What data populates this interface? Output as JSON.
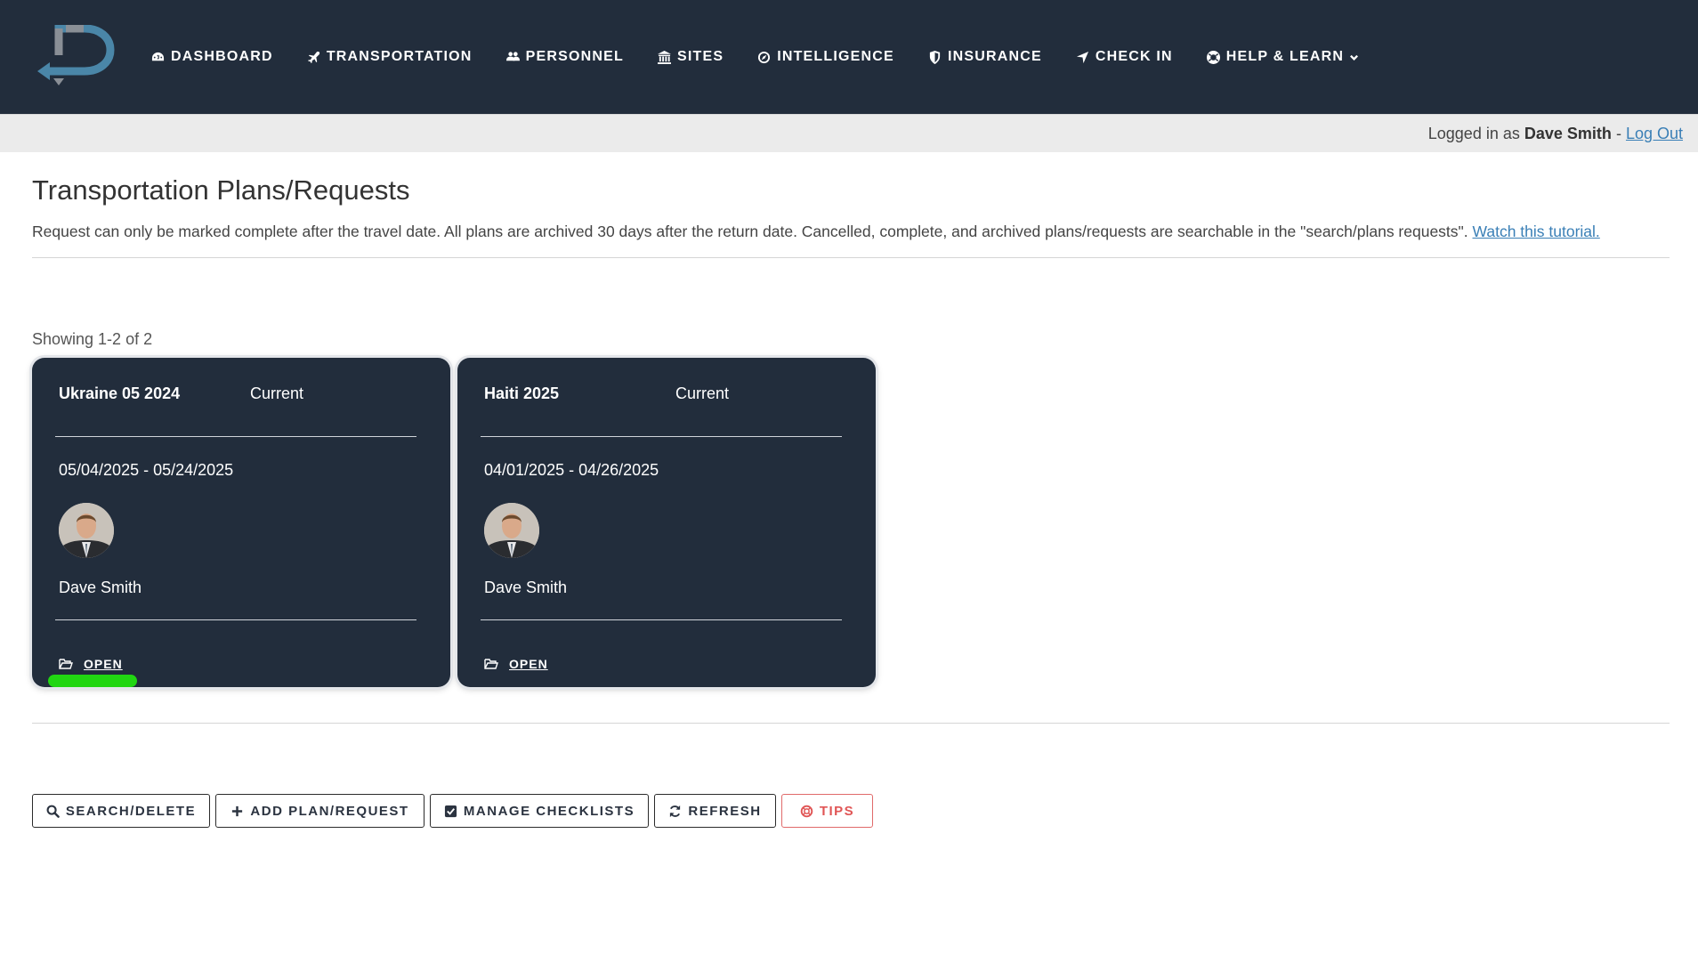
{
  "nav": {
    "items": [
      {
        "label": "Dashboard",
        "icon": "dashboard-icon"
      },
      {
        "label": "Transportation",
        "icon": "plane-icon"
      },
      {
        "label": "Personnel",
        "icon": "users-icon"
      },
      {
        "label": "Sites",
        "icon": "bank-icon"
      },
      {
        "label": "Intelligence",
        "icon": "compass-icon"
      },
      {
        "label": "Insurance",
        "icon": "shield-icon"
      },
      {
        "label": "Check In",
        "icon": "location-arrow-icon"
      },
      {
        "label": "Help & Learn",
        "icon": "life-ring-icon"
      }
    ]
  },
  "userbar": {
    "prefix": "Logged in as",
    "username": "Dave Smith",
    "separator": "-",
    "logout": "Log Out"
  },
  "page": {
    "title": "Transportation Plans/Requests",
    "description": "Request can only be marked complete after the travel date. All plans are archived 30 days after the return date. Cancelled, complete, and archived plans/requests are searchable in the \"search/plans requests\".",
    "tutorial_link": "Watch this tutorial.",
    "showing": "Showing 1-2 of 2"
  },
  "cards": [
    {
      "title": "Ukraine 05 2024",
      "status": "Current",
      "dates": "05/04/2025 - 05/24/2025",
      "person": "Dave Smith",
      "open": "Open"
    },
    {
      "title": "Haiti 2025",
      "status": "Current",
      "dates": "04/01/2025 - 04/26/2025",
      "person": "Dave Smith",
      "open": "Open"
    }
  ],
  "buttons": {
    "search": "Search/Delete",
    "add": "Add Plan/Request",
    "checklists": "Manage Checklists",
    "refresh": "Refresh",
    "tips": "Tips"
  },
  "colors": {
    "navbar": "#222d3c",
    "card": "#222d3c",
    "link": "#3a7fb6",
    "highlight": "#21d612",
    "tips": "#e05555"
  }
}
